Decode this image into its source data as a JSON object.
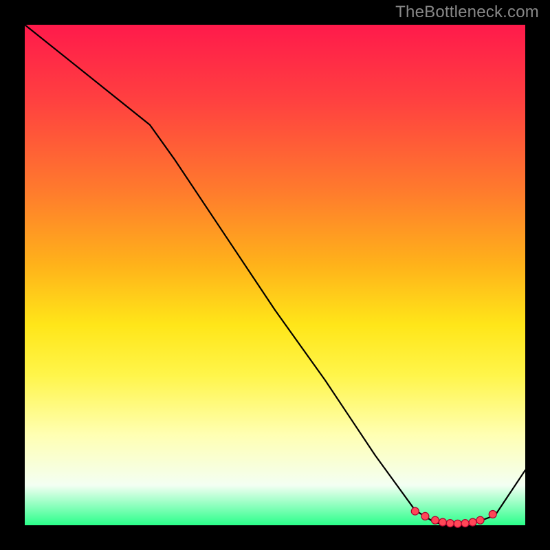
{
  "attribution": "TheBottleneck.com",
  "chart_data": {
    "type": "line",
    "title": "",
    "xlabel": "",
    "ylabel": "",
    "xlim": [
      0,
      100
    ],
    "ylim": [
      0,
      100
    ],
    "grid": false,
    "legend": false,
    "series": [
      {
        "name": "bottleneck-curve",
        "x": [
          0,
          10,
          20,
          25,
          30,
          40,
          50,
          60,
          70,
          78,
          82,
          86,
          90,
          94,
          100
        ],
        "y": [
          100,
          92,
          84,
          80,
          73,
          58,
          43,
          29,
          14,
          3,
          0.5,
          0,
          0.5,
          2,
          11
        ]
      }
    ],
    "markers": {
      "name": "highlight-cluster",
      "x": [
        78,
        80,
        82,
        83.5,
        85,
        86.5,
        88,
        89.5,
        91,
        93.5
      ],
      "y": [
        2.8,
        1.8,
        1.0,
        0.6,
        0.4,
        0.3,
        0.4,
        0.6,
        1.0,
        2.2
      ]
    }
  }
}
